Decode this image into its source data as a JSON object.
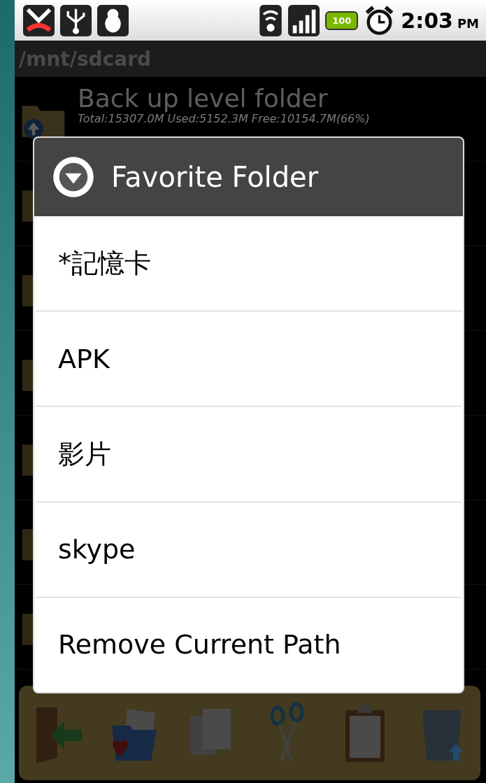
{
  "status_bar": {
    "time": "2:03",
    "ampm": "PM",
    "battery": "100"
  },
  "path_bar": {
    "path": "/mnt/sdcard"
  },
  "file_list": [
    {
      "kind": "up",
      "name": "Back up level folder",
      "detail": "Total:15307.0M Used:5152.3M Free:10154.7M(66%)"
    }
  ],
  "dialog": {
    "title": "Favorite Folder",
    "items": [
      {
        "label": "*記憶卡"
      },
      {
        "label": "APK"
      },
      {
        "label": "影片"
      },
      {
        "label": "skype"
      },
      {
        "label": "Remove Current Path"
      }
    ]
  }
}
